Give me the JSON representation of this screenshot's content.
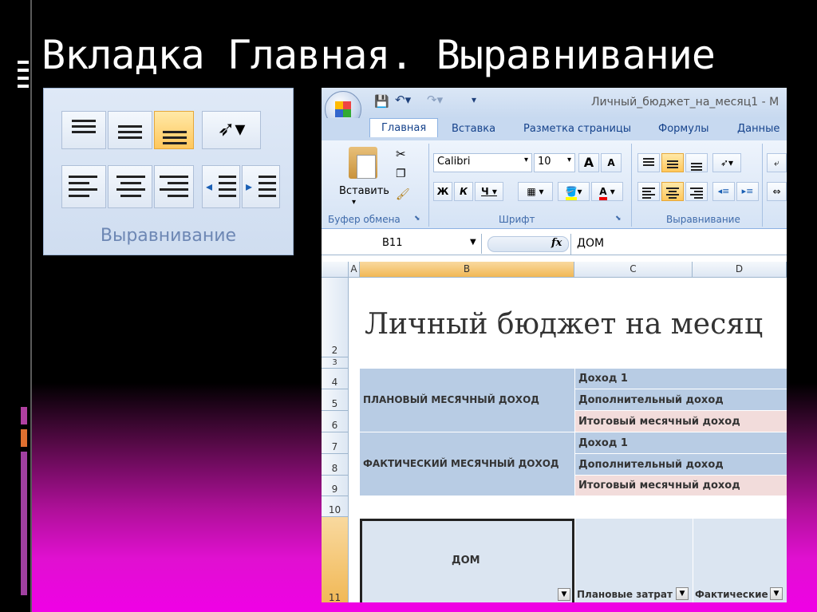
{
  "slide": {
    "title": "Вкладка Главная. Выравнивание",
    "zoom_group_label": "Выравнивание"
  },
  "excel": {
    "window_title": "Личный_бюджет_на_месяц1 - M",
    "tabs": [
      {
        "label": "Главная",
        "active": true
      },
      {
        "label": "Вставка"
      },
      {
        "label": "Разметка страницы"
      },
      {
        "label": "Формулы"
      },
      {
        "label": "Данные"
      }
    ],
    "clipboard": {
      "paste_label": "Вставить",
      "group_label": "Буфер обмена"
    },
    "font": {
      "name": "Calibri",
      "size": "10",
      "bold": "Ж",
      "italic": "К",
      "underline": "Ч",
      "group_label": "Шрифт",
      "grow": "A",
      "shrink": "A",
      "color_letter": "A"
    },
    "alignment": {
      "group_label": "Выравнивание"
    },
    "name_box": "B11",
    "fx": "fx",
    "formula_value": "ДОМ",
    "columns": [
      "A",
      "B",
      "C",
      "D"
    ],
    "rows": [
      "2",
      "3",
      "4",
      "5",
      "6",
      "7",
      "8",
      "9",
      "10",
      "11"
    ],
    "sheet_title": "Личный бюджет на месяц",
    "planned_label": "ПЛАНОВЫЙ МЕСЯЧНЫЙ ДОХОД",
    "actual_label": "ФАКТИЧЕСКИЙ МЕСЯЧНЫЙ ДОХОД",
    "income_rows": [
      "Доход 1",
      "Дополнительный доход",
      "Итоговый месячный доход"
    ],
    "table_header": {
      "home": "ДОМ",
      "planned": "Плановые затрат",
      "actual": "Фактические"
    }
  }
}
